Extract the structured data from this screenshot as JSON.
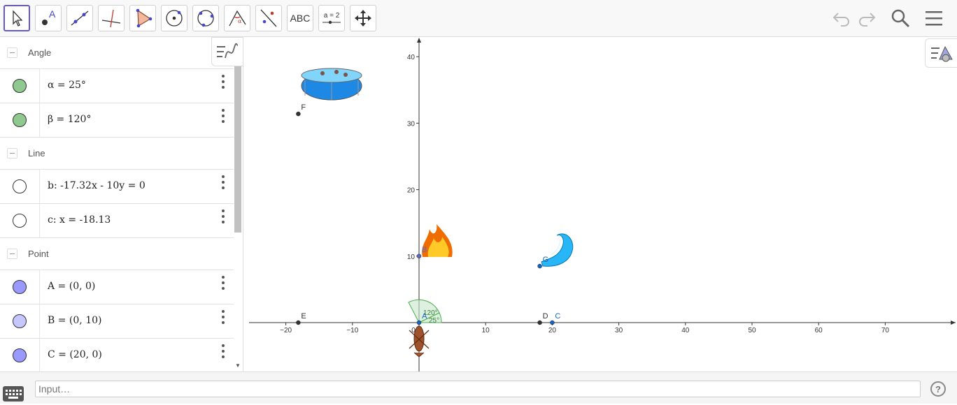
{
  "toolbar": {
    "tools": [
      {
        "name": "move-tool",
        "icon": "arrow-cursor-icon",
        "active": true
      },
      {
        "name": "point-tool",
        "icon": "point-icon"
      },
      {
        "name": "line-tool",
        "icon": "line-icon"
      },
      {
        "name": "perpendicular-tool",
        "icon": "perpendicular-line-icon"
      },
      {
        "name": "polygon-tool",
        "icon": "polygon-icon"
      },
      {
        "name": "circle-center-tool",
        "icon": "circle-center-icon"
      },
      {
        "name": "circle-three-points-tool",
        "icon": "circle-three-points-icon"
      },
      {
        "name": "angle-tool",
        "icon": "angle-icon"
      },
      {
        "name": "reflect-tool",
        "icon": "reflect-icon"
      },
      {
        "name": "text-tool",
        "label": "ABC"
      },
      {
        "name": "slider-tool",
        "label": "a = 2"
      },
      {
        "name": "move-graphics-tool",
        "icon": "move-arrows-icon"
      }
    ],
    "undo_icon": "undo-icon",
    "redo_icon": "redo-icon",
    "search_icon": "search-icon",
    "menu_icon": "hamburger-menu-icon"
  },
  "algebra": {
    "groups": [
      {
        "label": "Angle",
        "items": [
          {
            "text": "α = 25°",
            "color": "#8fc98f"
          },
          {
            "text": "β = 120°",
            "color": "#8fc98f"
          }
        ]
      },
      {
        "label": "Line",
        "items": [
          {
            "text": "b: -17.32x - 10y = 0",
            "color": "#ffffff"
          },
          {
            "text": "c: x = -18.13",
            "color": "#ffffff"
          }
        ]
      },
      {
        "label": "Point",
        "items": [
          {
            "text": "A = (0, 0)",
            "color": "#9999ff"
          },
          {
            "text": "B = (0, 10)",
            "color": "#c7c7ff"
          },
          {
            "text": "C = (20, 0)",
            "color": "#9999ff"
          }
        ]
      }
    ]
  },
  "graphics": {
    "x_ticks": [
      "−20",
      "−10",
      "0",
      "10",
      "20",
      "30",
      "40",
      "50",
      "60",
      "70"
    ],
    "y_ticks": [
      "10",
      "20",
      "30",
      "40"
    ],
    "points": [
      {
        "label": "A",
        "x": 0,
        "y": 0,
        "color": "#1565c0"
      },
      {
        "label": "B",
        "x": 0,
        "y": 10,
        "color": "#5c6bc0"
      },
      {
        "label": "C",
        "x": 20,
        "y": 0,
        "color": "#1565c0"
      },
      {
        "label": "D",
        "x": 18.13,
        "y": 0,
        "color": "#333333"
      },
      {
        "label": "E",
        "x": -18.13,
        "y": 0,
        "color": "#333333"
      },
      {
        "label": "F",
        "x": -18.13,
        "y": 31.4,
        "color": "#333333"
      },
      {
        "label": "G",
        "x": 18.13,
        "y": 8.5,
        "color": "#1565c0"
      }
    ],
    "angle_labels": {
      "beta": "120°",
      "alpha": "25°"
    },
    "images": [
      "pool-image",
      "fire-image",
      "water-wave-image",
      "lobster-image"
    ]
  },
  "inputbar": {
    "placeholder": "Input…",
    "help_label": "?"
  }
}
